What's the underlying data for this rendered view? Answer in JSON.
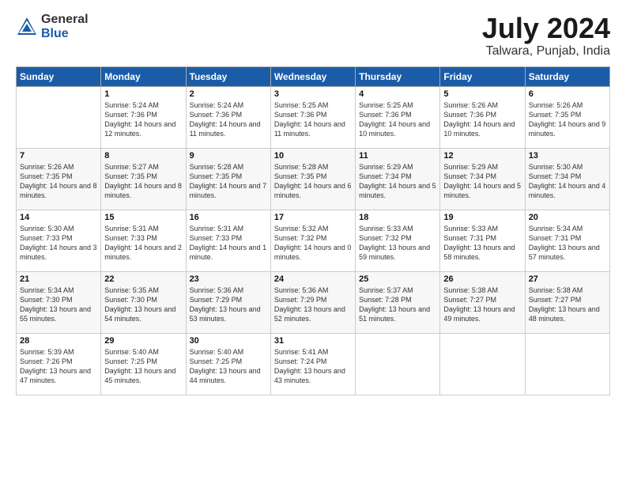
{
  "logo": {
    "general": "General",
    "blue": "Blue"
  },
  "title": {
    "month_year": "July 2024",
    "location": "Talwara, Punjab, India"
  },
  "headers": [
    "Sunday",
    "Monday",
    "Tuesday",
    "Wednesday",
    "Thursday",
    "Friday",
    "Saturday"
  ],
  "weeks": [
    [
      {
        "day": "",
        "sunrise": "",
        "sunset": "",
        "daylight": ""
      },
      {
        "day": "1",
        "sunrise": "Sunrise: 5:24 AM",
        "sunset": "Sunset: 7:36 PM",
        "daylight": "Daylight: 14 hours and 12 minutes."
      },
      {
        "day": "2",
        "sunrise": "Sunrise: 5:24 AM",
        "sunset": "Sunset: 7:36 PM",
        "daylight": "Daylight: 14 hours and 11 minutes."
      },
      {
        "day": "3",
        "sunrise": "Sunrise: 5:25 AM",
        "sunset": "Sunset: 7:36 PM",
        "daylight": "Daylight: 14 hours and 11 minutes."
      },
      {
        "day": "4",
        "sunrise": "Sunrise: 5:25 AM",
        "sunset": "Sunset: 7:36 PM",
        "daylight": "Daylight: 14 hours and 10 minutes."
      },
      {
        "day": "5",
        "sunrise": "Sunrise: 5:26 AM",
        "sunset": "Sunset: 7:36 PM",
        "daylight": "Daylight: 14 hours and 10 minutes."
      },
      {
        "day": "6",
        "sunrise": "Sunrise: 5:26 AM",
        "sunset": "Sunset: 7:35 PM",
        "daylight": "Daylight: 14 hours and 9 minutes."
      }
    ],
    [
      {
        "day": "7",
        "sunrise": "Sunrise: 5:26 AM",
        "sunset": "Sunset: 7:35 PM",
        "daylight": "Daylight: 14 hours and 8 minutes."
      },
      {
        "day": "8",
        "sunrise": "Sunrise: 5:27 AM",
        "sunset": "Sunset: 7:35 PM",
        "daylight": "Daylight: 14 hours and 8 minutes."
      },
      {
        "day": "9",
        "sunrise": "Sunrise: 5:28 AM",
        "sunset": "Sunset: 7:35 PM",
        "daylight": "Daylight: 14 hours and 7 minutes."
      },
      {
        "day": "10",
        "sunrise": "Sunrise: 5:28 AM",
        "sunset": "Sunset: 7:35 PM",
        "daylight": "Daylight: 14 hours and 6 minutes."
      },
      {
        "day": "11",
        "sunrise": "Sunrise: 5:29 AM",
        "sunset": "Sunset: 7:34 PM",
        "daylight": "Daylight: 14 hours and 5 minutes."
      },
      {
        "day": "12",
        "sunrise": "Sunrise: 5:29 AM",
        "sunset": "Sunset: 7:34 PM",
        "daylight": "Daylight: 14 hours and 5 minutes."
      },
      {
        "day": "13",
        "sunrise": "Sunrise: 5:30 AM",
        "sunset": "Sunset: 7:34 PM",
        "daylight": "Daylight: 14 hours and 4 minutes."
      }
    ],
    [
      {
        "day": "14",
        "sunrise": "Sunrise: 5:30 AM",
        "sunset": "Sunset: 7:33 PM",
        "daylight": "Daylight: 14 hours and 3 minutes."
      },
      {
        "day": "15",
        "sunrise": "Sunrise: 5:31 AM",
        "sunset": "Sunset: 7:33 PM",
        "daylight": "Daylight: 14 hours and 2 minutes."
      },
      {
        "day": "16",
        "sunrise": "Sunrise: 5:31 AM",
        "sunset": "Sunset: 7:33 PM",
        "daylight": "Daylight: 14 hours and 1 minute."
      },
      {
        "day": "17",
        "sunrise": "Sunrise: 5:32 AM",
        "sunset": "Sunset: 7:32 PM",
        "daylight": "Daylight: 14 hours and 0 minutes."
      },
      {
        "day": "18",
        "sunrise": "Sunrise: 5:33 AM",
        "sunset": "Sunset: 7:32 PM",
        "daylight": "Daylight: 13 hours and 59 minutes."
      },
      {
        "day": "19",
        "sunrise": "Sunrise: 5:33 AM",
        "sunset": "Sunset: 7:31 PM",
        "daylight": "Daylight: 13 hours and 58 minutes."
      },
      {
        "day": "20",
        "sunrise": "Sunrise: 5:34 AM",
        "sunset": "Sunset: 7:31 PM",
        "daylight": "Daylight: 13 hours and 57 minutes."
      }
    ],
    [
      {
        "day": "21",
        "sunrise": "Sunrise: 5:34 AM",
        "sunset": "Sunset: 7:30 PM",
        "daylight": "Daylight: 13 hours and 55 minutes."
      },
      {
        "day": "22",
        "sunrise": "Sunrise: 5:35 AM",
        "sunset": "Sunset: 7:30 PM",
        "daylight": "Daylight: 13 hours and 54 minutes."
      },
      {
        "day": "23",
        "sunrise": "Sunrise: 5:36 AM",
        "sunset": "Sunset: 7:29 PM",
        "daylight": "Daylight: 13 hours and 53 minutes."
      },
      {
        "day": "24",
        "sunrise": "Sunrise: 5:36 AM",
        "sunset": "Sunset: 7:29 PM",
        "daylight": "Daylight: 13 hours and 52 minutes."
      },
      {
        "day": "25",
        "sunrise": "Sunrise: 5:37 AM",
        "sunset": "Sunset: 7:28 PM",
        "daylight": "Daylight: 13 hours and 51 minutes."
      },
      {
        "day": "26",
        "sunrise": "Sunrise: 5:38 AM",
        "sunset": "Sunset: 7:27 PM",
        "daylight": "Daylight: 13 hours and 49 minutes."
      },
      {
        "day": "27",
        "sunrise": "Sunrise: 5:38 AM",
        "sunset": "Sunset: 7:27 PM",
        "daylight": "Daylight: 13 hours and 48 minutes."
      }
    ],
    [
      {
        "day": "28",
        "sunrise": "Sunrise: 5:39 AM",
        "sunset": "Sunset: 7:26 PM",
        "daylight": "Daylight: 13 hours and 47 minutes."
      },
      {
        "day": "29",
        "sunrise": "Sunrise: 5:40 AM",
        "sunset": "Sunset: 7:25 PM",
        "daylight": "Daylight: 13 hours and 45 minutes."
      },
      {
        "day": "30",
        "sunrise": "Sunrise: 5:40 AM",
        "sunset": "Sunset: 7:25 PM",
        "daylight": "Daylight: 13 hours and 44 minutes."
      },
      {
        "day": "31",
        "sunrise": "Sunrise: 5:41 AM",
        "sunset": "Sunset: 7:24 PM",
        "daylight": "Daylight: 13 hours and 43 minutes."
      },
      {
        "day": "",
        "sunrise": "",
        "sunset": "",
        "daylight": ""
      },
      {
        "day": "",
        "sunrise": "",
        "sunset": "",
        "daylight": ""
      },
      {
        "day": "",
        "sunrise": "",
        "sunset": "",
        "daylight": ""
      }
    ]
  ]
}
